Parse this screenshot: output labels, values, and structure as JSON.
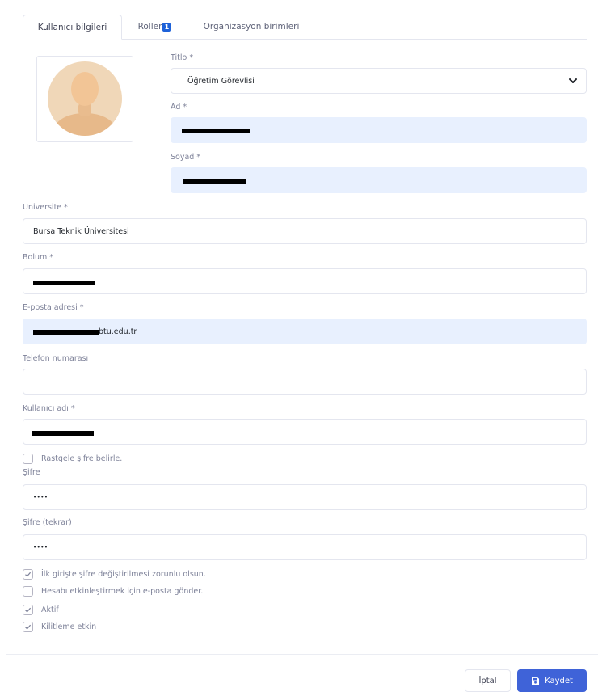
{
  "tabs": [
    {
      "label": "Kullanıcı bilgileri",
      "active": true
    },
    {
      "label": "Roller",
      "badge": "1",
      "active": false
    },
    {
      "label": "Organizasyon birimleri",
      "active": false
    }
  ],
  "fields": {
    "title": {
      "label": "Titlo *",
      "value": "Öğretim Görevlisi"
    },
    "first_name": {
      "label": "Ad *",
      "value": ""
    },
    "last_name": {
      "label": "Soyad *",
      "value": ""
    },
    "university": {
      "label": "Universite *",
      "value": "Bursa Teknik Üniversitesi"
    },
    "department": {
      "label": "Bolum *",
      "value": ""
    },
    "email": {
      "label": "E-posta adresi *",
      "value": "btu.edu.tr"
    },
    "phone": {
      "label": "Telefon numarası",
      "value": ""
    },
    "username": {
      "label": "Kullanıcı adı *",
      "value": ""
    },
    "password": {
      "label": "Şifre",
      "value": "••••"
    },
    "password_repeat": {
      "label": "Şifre (tekrar)",
      "value": "••••"
    }
  },
  "checkboxes": {
    "random_password": {
      "label": "Rastgele şifre belirle.",
      "checked": false
    },
    "force_change": {
      "label": "İlk girişte şifre değiştirilmesi zorunlu olsun.",
      "checked": true
    },
    "send_activation": {
      "label": "Hesabı etkinleştirmek için e-posta gönder.",
      "checked": false
    },
    "active": {
      "label": "Aktif",
      "checked": true
    },
    "lockout": {
      "label": "Kilitleme etkin",
      "checked": true
    }
  },
  "buttons": {
    "cancel": "İptal",
    "save": "Kaydet"
  },
  "colors": {
    "primary": "#3f63d8",
    "autofill": "#e8f0fe",
    "badge": "#1e62d9",
    "avatar_bg": "#f0d7b8"
  },
  "icons": {
    "avatar": "user-placeholder",
    "chevron": "chevron-down-icon",
    "save": "floppy-disk-icon",
    "check": "check-icon"
  }
}
